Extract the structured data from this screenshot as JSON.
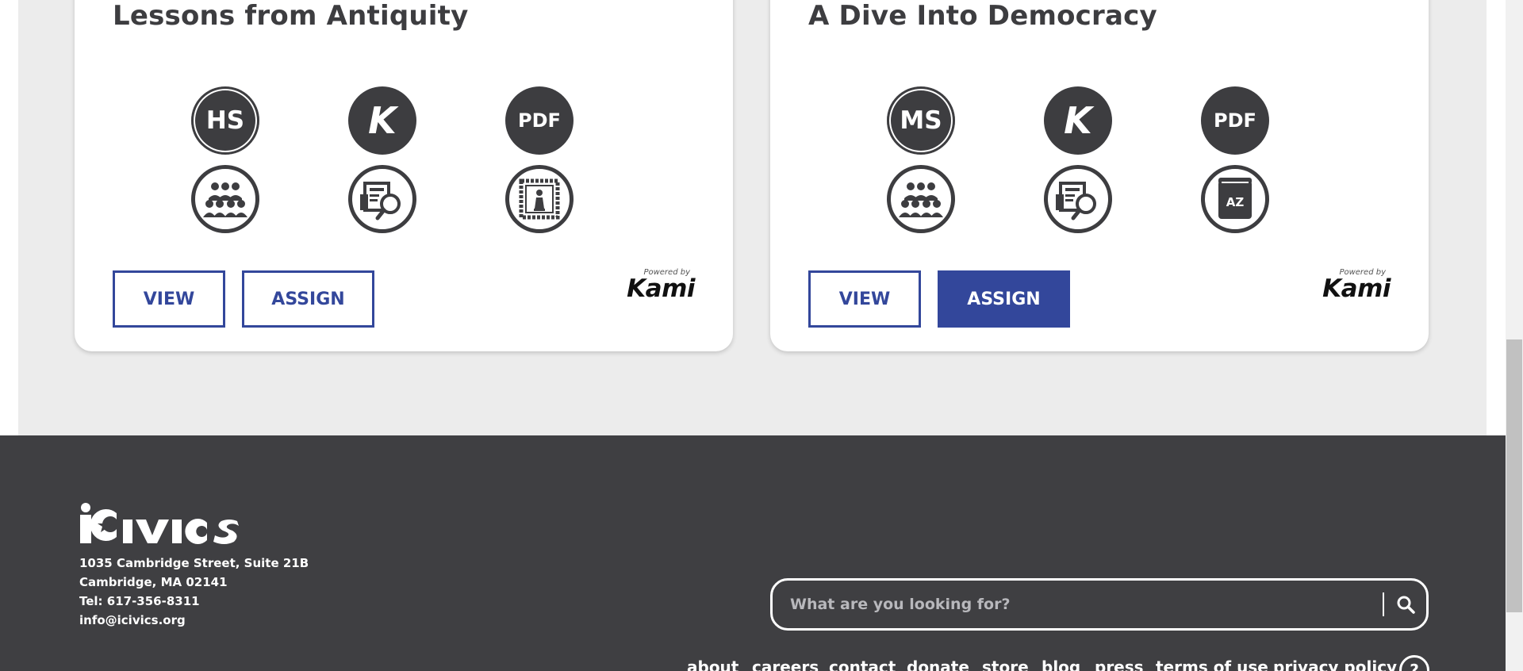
{
  "cards": [
    {
      "title": "Lessons from Antiquity",
      "grade_badge": "HS",
      "kami_badge": "K",
      "pdf_badge": "PDF",
      "view_label": "VIEW",
      "assign_label": "ASSIGN",
      "powered_by": "Powered by",
      "kami_brand": "Kami"
    },
    {
      "title": "A Dive Into Democracy",
      "grade_badge": "MS",
      "kami_badge": "K",
      "pdf_badge": "PDF",
      "dictionary_badge": "AZ",
      "view_label": "VIEW",
      "assign_label": "ASSIGN",
      "powered_by": "Powered by",
      "kami_brand": "Kami"
    }
  ],
  "footer": {
    "logo_text": "iCivics",
    "address": {
      "street": "1035 Cambridge Street, Suite 21B",
      "city": "Cambridge, MA 02141",
      "tel": "Tel: 617-356-8311",
      "email": "info@icivics.org"
    },
    "search": {
      "placeholder": "What are you looking for?"
    },
    "nav": [
      "about",
      "careers",
      "contact",
      "donate",
      "store",
      "blog",
      "press",
      "terms of use",
      "privacy policy"
    ],
    "help_label": "?"
  },
  "colors": {
    "accent": "#33479b",
    "icon_dark": "#3d3d40",
    "footer_bg": "#3f3f42",
    "page_bg": "#ececec"
  },
  "icons": {
    "group": "students-group-icon",
    "newspaper": "newspaper-search-icon",
    "game": "board-game-icon",
    "dictionary": "dictionary-book-icon",
    "search": "magnifier-icon",
    "help": "help-circle-icon"
  }
}
